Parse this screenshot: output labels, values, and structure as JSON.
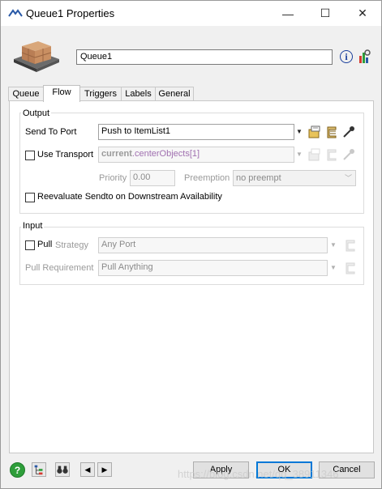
{
  "window": {
    "title": "Queue1  Properties",
    "minimize": "—",
    "maximize": "☐",
    "close": "✕"
  },
  "object": {
    "name": "Queue1"
  },
  "tabs": [
    "Queue",
    "Flow",
    "Triggers",
    "Labels",
    "General"
  ],
  "active_tab": "Flow",
  "output": {
    "group_label": "Output",
    "send_to_port_label": "Send To Port",
    "send_to_port_value": "Push to ItemList1",
    "use_transport_label": "Use Transport",
    "use_transport_value_kw": "current",
    "use_transport_value_prop": ".centerObjects",
    "use_transport_value_idx": "[1]",
    "priority_label": "Priority",
    "priority_value": "0.00",
    "preemption_label": "Preemption",
    "preemption_value": "no preempt",
    "reevaluate_label": "Reevaluate Sendto on Downstream Availability"
  },
  "input": {
    "group_label": "Input",
    "pull_label": "Pull",
    "strategy_label": "Strategy",
    "strategy_value": "Any Port",
    "pull_requirement_label": "Pull Requirement",
    "pull_requirement_value": "Pull Anything"
  },
  "buttons": {
    "apply": "Apply",
    "ok": "OK",
    "cancel": "Cancel"
  },
  "watermark": "https://blog.csdn.net/qq_38911346"
}
